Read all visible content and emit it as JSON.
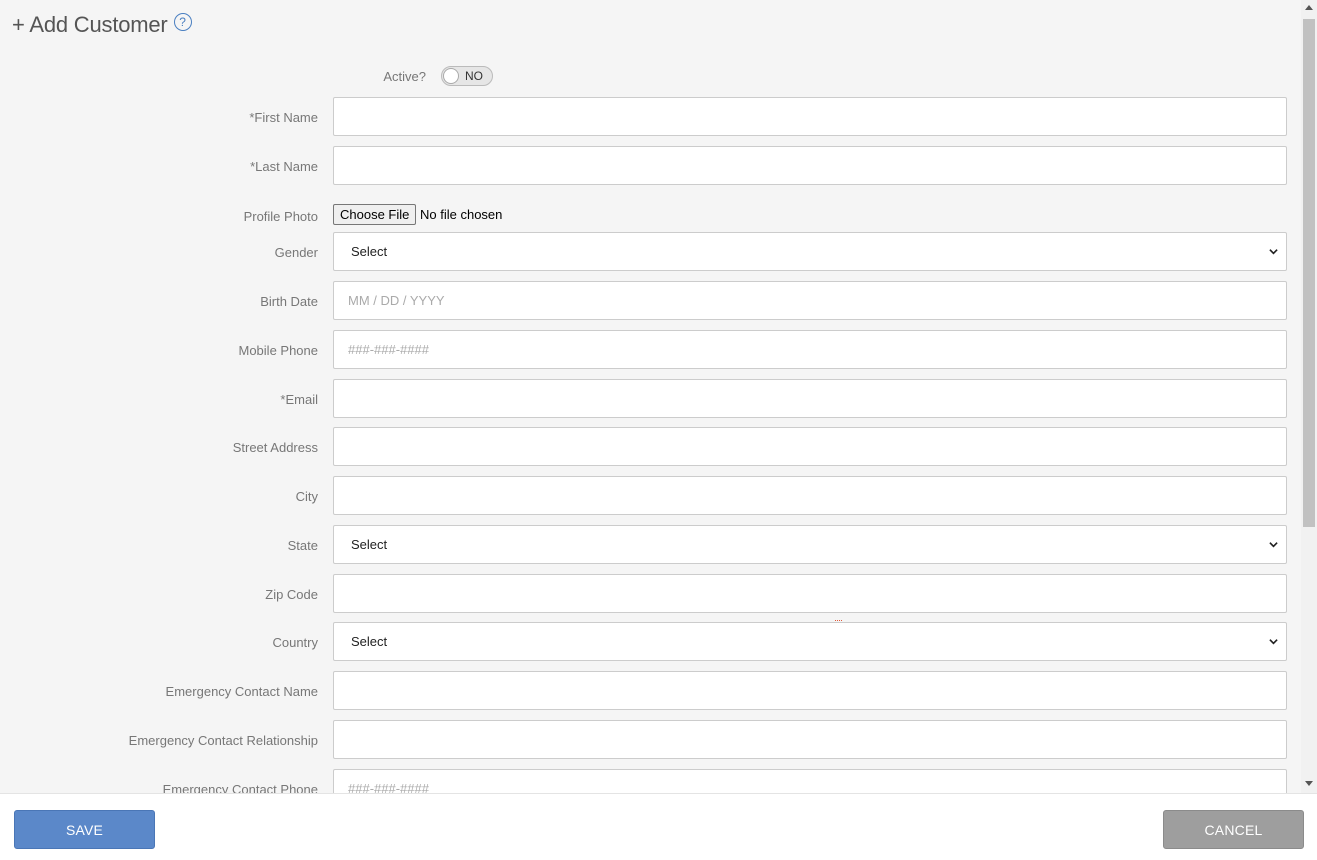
{
  "header": {
    "title": "+ Add Customer",
    "help_icon": "?"
  },
  "active": {
    "label": "Active?",
    "toggle_text": "NO"
  },
  "fields": {
    "first_name": {
      "label": "*First Name",
      "value": "",
      "placeholder": ""
    },
    "last_name": {
      "label": "*Last Name",
      "value": "",
      "placeholder": ""
    },
    "profile_photo": {
      "label": "Profile Photo",
      "button": "Choose File",
      "status": "No file chosen"
    },
    "gender": {
      "label": "Gender",
      "selected": "Select"
    },
    "birth_date": {
      "label": "Birth Date",
      "value": "",
      "placeholder": "MM / DD / YYYY"
    },
    "mobile_phone": {
      "label": "Mobile Phone",
      "value": "",
      "placeholder": "###-###-####"
    },
    "email": {
      "label": "*Email",
      "value": "",
      "placeholder": ""
    },
    "street_address": {
      "label": "Street Address",
      "value": "",
      "placeholder": ""
    },
    "city": {
      "label": "City",
      "value": "",
      "placeholder": ""
    },
    "state": {
      "label": "State",
      "selected": "Select"
    },
    "zip_code": {
      "label": "Zip Code",
      "value": "",
      "placeholder": ""
    },
    "country": {
      "label": "Country",
      "selected": "Select"
    },
    "emergency_contact_name": {
      "label": "Emergency Contact Name",
      "value": "",
      "placeholder": ""
    },
    "emergency_contact_relationship": {
      "label": "Emergency Contact Relationship",
      "value": "",
      "placeholder": ""
    },
    "emergency_contact_phone": {
      "label": "Emergency Contact Phone",
      "value": "",
      "placeholder": "###-###-####"
    }
  },
  "footer": {
    "save_label": "SAVE",
    "cancel_label": "CANCEL"
  },
  "colors": {
    "save": "#5b88c9",
    "cancel": "#9e9e9e",
    "help": "#4a7fc1"
  },
  "icons": {
    "help": "help-circle-icon",
    "select": "chevron-down-icon"
  }
}
